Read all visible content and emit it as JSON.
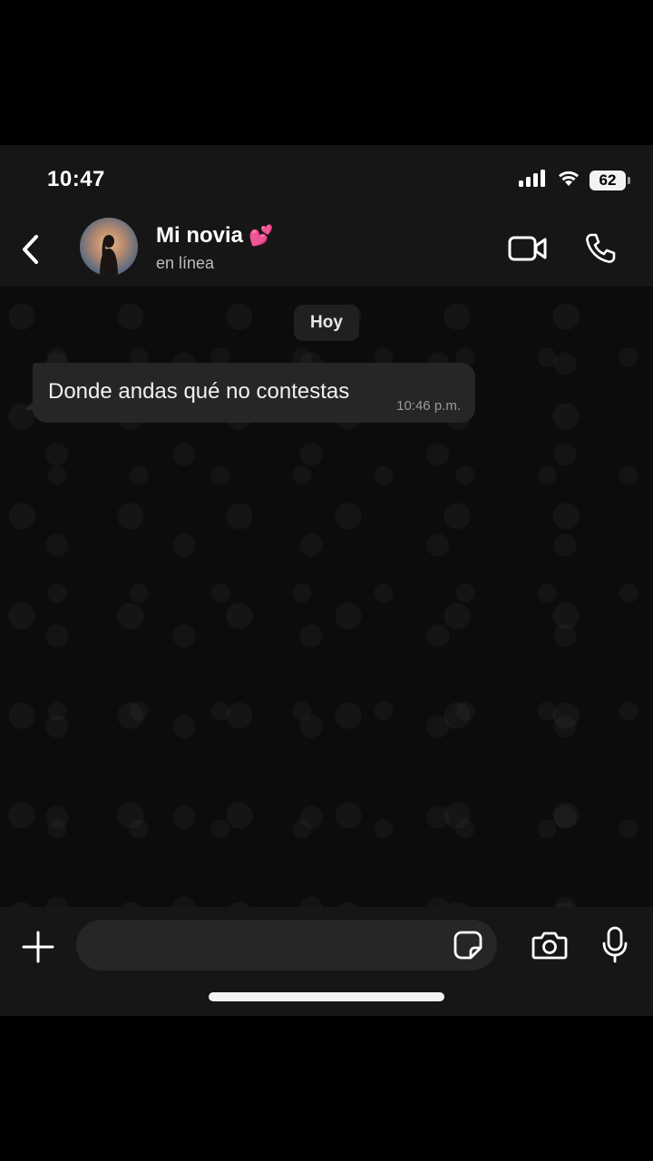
{
  "status_bar": {
    "time": "10:47",
    "battery_level": "62",
    "signal_icon": "cellular-signal-icon",
    "wifi_icon": "wifi-icon"
  },
  "header": {
    "back_icon": "chevron-left-icon",
    "contact_name": "Mi novia",
    "contact_emoji": "💕",
    "contact_status": "en línea",
    "video_icon": "video-camera-icon",
    "call_icon": "phone-icon"
  },
  "chat": {
    "date_label": "Hoy",
    "messages": [
      {
        "direction": "incoming",
        "text": "Donde andas qué no contestas",
        "time": "10:46 p.m."
      }
    ]
  },
  "input_bar": {
    "plus_icon": "plus-icon",
    "message_value": "",
    "sticker_icon": "sticker-icon",
    "camera_icon": "camera-icon",
    "mic_icon": "microphone-icon"
  },
  "colors": {
    "background": "#0c0c0c",
    "bar_background": "#161616",
    "bubble_incoming": "#262626",
    "heart_pink": "#ff4fa6",
    "text_primary": "#ffffff",
    "text_secondary": "#bdbdbd"
  }
}
